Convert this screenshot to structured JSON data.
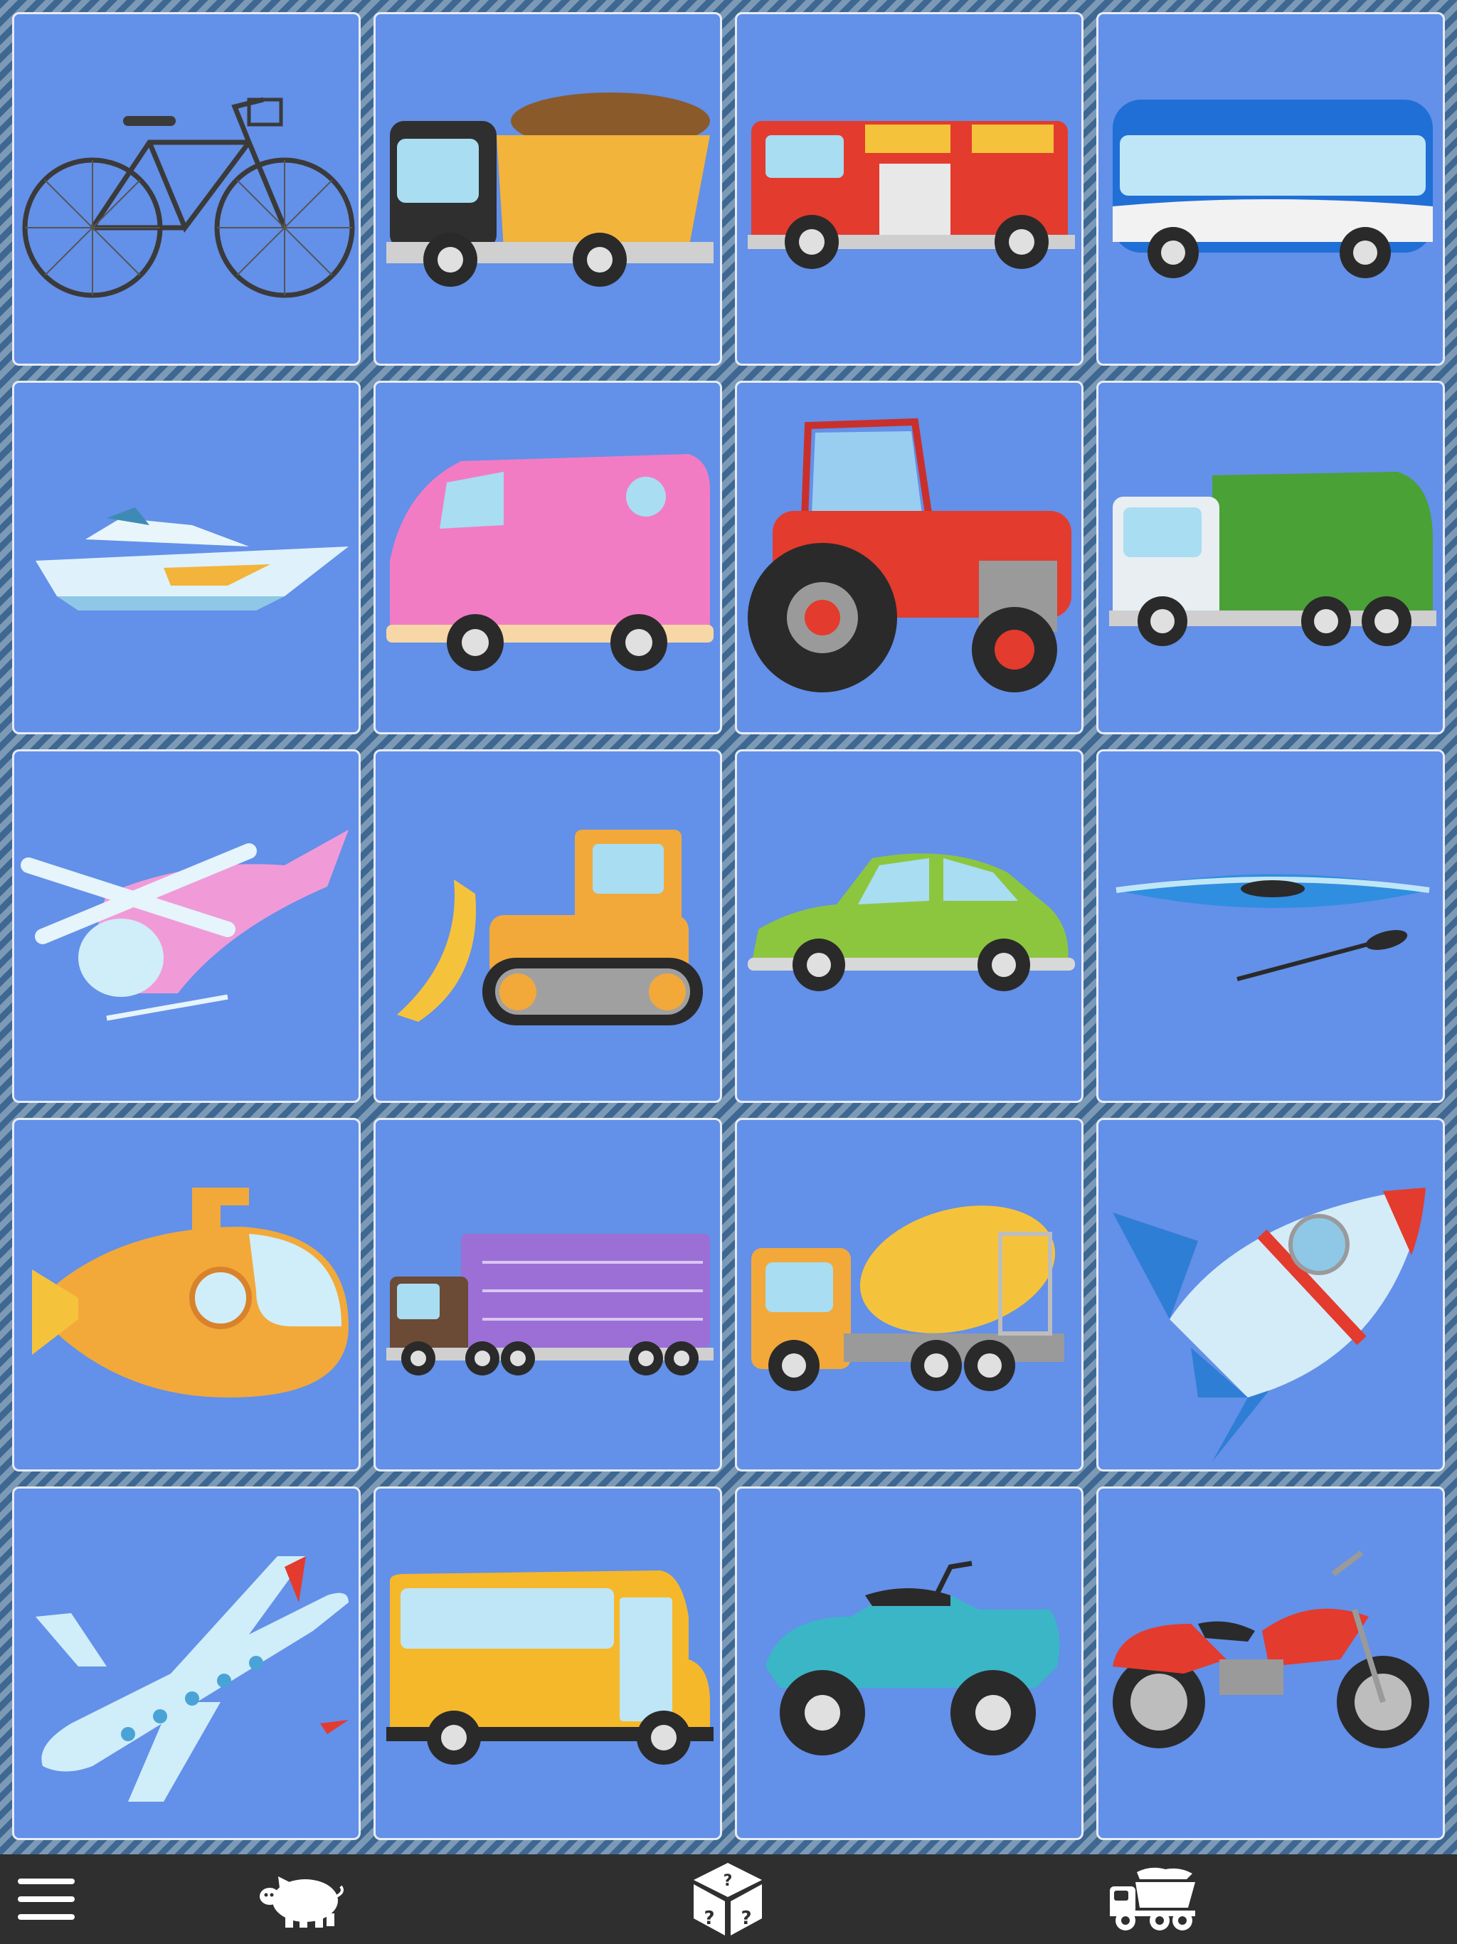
{
  "theme": {
    "card_bg": "#6390e8",
    "card_border": "#e6ecf7",
    "toolbar_bg": "#2f2f2f",
    "icon_color": "#ffffff"
  },
  "cards": [
    {
      "name": "bicycle",
      "icon": "bicycle"
    },
    {
      "name": "dump-truck",
      "icon": "dump-truck"
    },
    {
      "name": "fire-truck",
      "icon": "fire-truck"
    },
    {
      "name": "bus",
      "icon": "bus"
    },
    {
      "name": "speedboat",
      "icon": "speedboat"
    },
    {
      "name": "van",
      "icon": "van"
    },
    {
      "name": "tractor",
      "icon": "tractor"
    },
    {
      "name": "garbage-truck",
      "icon": "garbage-truck"
    },
    {
      "name": "helicopter",
      "icon": "helicopter"
    },
    {
      "name": "bulldozer",
      "icon": "bulldozer"
    },
    {
      "name": "car",
      "icon": "car"
    },
    {
      "name": "kayak",
      "icon": "kayak"
    },
    {
      "name": "submarine",
      "icon": "submarine"
    },
    {
      "name": "semi-truck",
      "icon": "semi-truck"
    },
    {
      "name": "cement-mixer",
      "icon": "cement-mixer"
    },
    {
      "name": "rocket",
      "icon": "rocket"
    },
    {
      "name": "airplane",
      "icon": "airplane"
    },
    {
      "name": "school-bus",
      "icon": "school-bus"
    },
    {
      "name": "quad-bike",
      "icon": "quad-bike"
    },
    {
      "name": "motorcycle",
      "icon": "motorcycle"
    }
  ],
  "toolbar": {
    "buttons": [
      {
        "name": "menu-button",
        "icon": "hamburger-menu-icon"
      },
      {
        "name": "animals-category-button",
        "icon": "pig-icon"
      },
      {
        "name": "random-button",
        "icon": "dice-icon"
      },
      {
        "name": "vehicles-category-button",
        "icon": "dump-truck-icon"
      }
    ]
  }
}
